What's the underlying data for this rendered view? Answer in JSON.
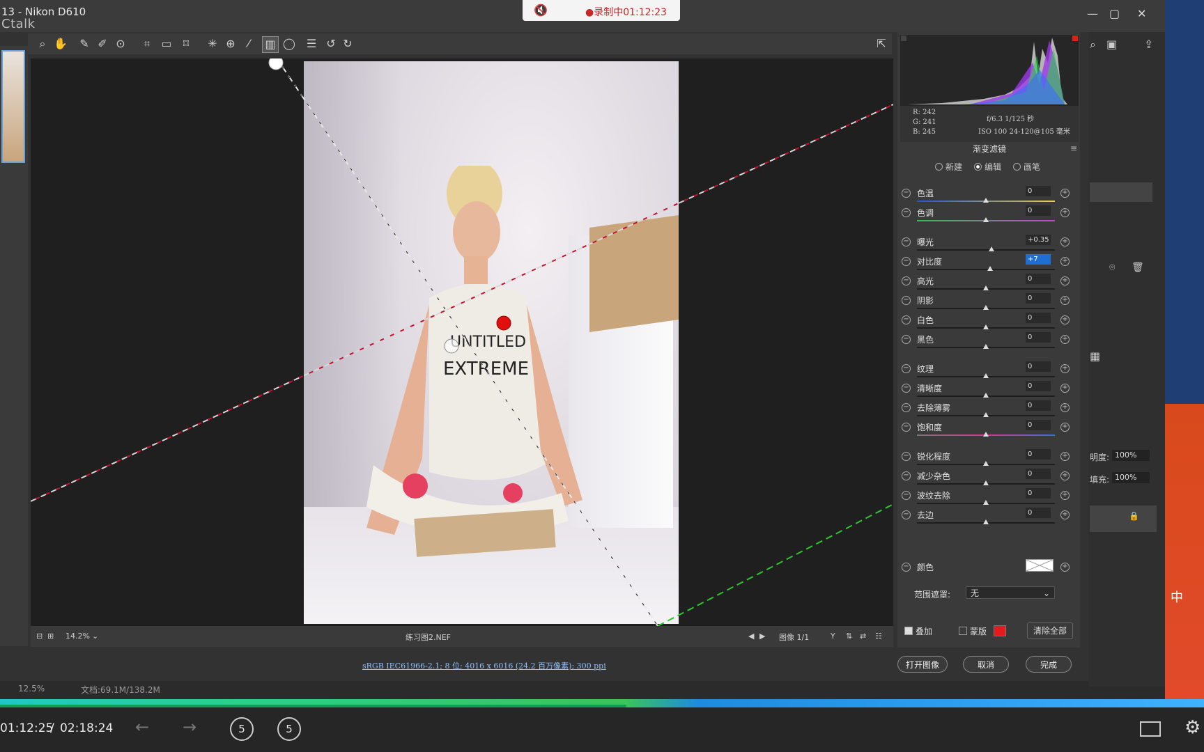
{
  "window": {
    "title": "13 - Nikon D610",
    "overlay_logo": "Ctalk",
    "recording_text": "●录制中01:12:23"
  },
  "canvas": {
    "zoom": "14.2%",
    "filename": "练习图2.NEF",
    "image_counter": "图像 1/1",
    "file_info": "sRGB IEC61966-2.1; 8 位; 4016 x 6016 (24.2 百万像素); 300 ppi"
  },
  "histogram": {
    "rgb": {
      "r": "R:  242",
      "g": "G:  241",
      "b": "B:  245"
    },
    "exif": {
      "line1": "f/6.3  1/125 秒",
      "line2": "ISO 100  24-120@105 毫米"
    }
  },
  "filter_panel": {
    "title": "渐变滤镜",
    "modes": [
      "新建",
      "编辑",
      "画笔"
    ],
    "selected_mode": "编辑",
    "sliders": [
      {
        "label": "色温",
        "value": "0",
        "pos": 0.5
      },
      {
        "label": "色调",
        "value": "0",
        "pos": 0.5
      },
      {
        "label": "曝光",
        "value": "+0.35",
        "pos": 0.54
      },
      {
        "label": "对比度",
        "value": "+7",
        "pos": 0.53
      },
      {
        "label": "高光",
        "value": "0",
        "pos": 0.5
      },
      {
        "label": "阴影",
        "value": "0",
        "pos": 0.5
      },
      {
        "label": "白色",
        "value": "0",
        "pos": 0.5
      },
      {
        "label": "黑色",
        "value": "0",
        "pos": 0.5
      },
      {
        "label": "纹理",
        "value": "0",
        "pos": 0.5
      },
      {
        "label": "清晰度",
        "value": "0",
        "pos": 0.5
      },
      {
        "label": "去除薄雾",
        "value": "0",
        "pos": 0.5
      },
      {
        "label": "饱和度",
        "value": "0",
        "pos": 0.5
      },
      {
        "label": "锐化程度",
        "value": "0",
        "pos": 0.5
      },
      {
        "label": "减少杂色",
        "value": "0",
        "pos": 0.5
      },
      {
        "label": "波纹去除",
        "value": "0",
        "pos": 0.5
      },
      {
        "label": "去边",
        "value": "0",
        "pos": 0.5
      }
    ],
    "color_label": "颜色",
    "range_mask_label": "范围遮罩:",
    "range_mask_value": "无",
    "overlay_label": "叠加",
    "mask_label": "蒙版",
    "clear_all": "清除全部"
  },
  "dialog_buttons": {
    "open": "打开图像",
    "cancel": "取消",
    "done": "完成"
  },
  "ps_status": {
    "zoom": "12.5%",
    "doc": "文档:69.1M/138.2M"
  },
  "ps_right": {
    "opacity_label": "明度:",
    "opacity_value": "100%",
    "fill_label": "填充:",
    "fill_value": "100%"
  },
  "player": {
    "current": "01:12:25",
    "separator": "/",
    "total": "02:18:24",
    "progress": 0.52
  }
}
